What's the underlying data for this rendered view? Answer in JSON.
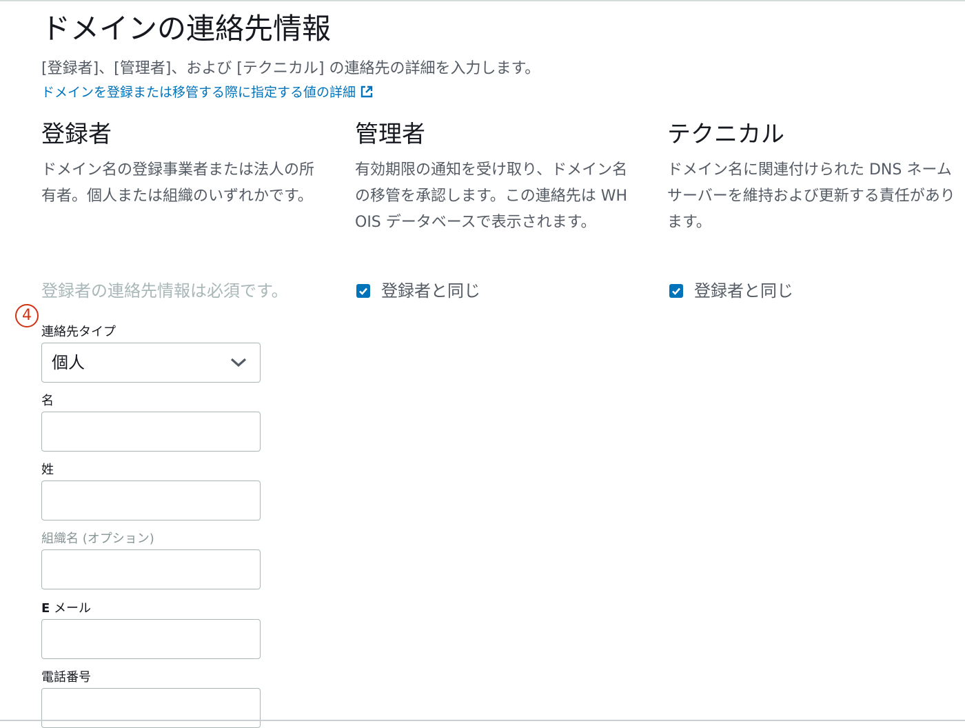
{
  "page": {
    "title": "ドメインの連絡先情報",
    "description": "[登録者]、[管理者]、および [テクニカル] の連絡先の詳細を入力します。",
    "learn_more_link": "ドメインを登録または移管する際に指定する値の詳細"
  },
  "columns": [
    {
      "heading": "登録者",
      "description": "ドメイン名の登録事業者または法人の所有者。個人または組織のいずれかです。"
    },
    {
      "heading": "管理者",
      "description": "有効期限の通知を受け取り、ドメイン名の移管を承認します。この連絡先は WHOIS データベースで表示されます。"
    },
    {
      "heading": "テクニカル",
      "description": "ドメイン名に関連付けられた DNS ネームサーバーを維持および更新する責任があります。"
    }
  ],
  "registrant": {
    "required_note": "登録者の連絡先情報は必須です。"
  },
  "admin": {
    "same_as_registrant_label": "登録者と同じ",
    "same_as_registrant_checked": true
  },
  "technical": {
    "same_as_registrant_label": "登録者と同じ",
    "same_as_registrant_checked": true
  },
  "step_marker": "4",
  "form": {
    "contact_type_label": "連絡先タイプ",
    "contact_type_value": "個人",
    "first_name_label": "名",
    "first_name_value": "",
    "last_name_label": "姓",
    "last_name_value": "",
    "organization_label": "組織名 (オプション)",
    "organization_value": "",
    "email_label_bold": "E",
    "email_label_rest": " メール",
    "email_value": "",
    "phone_label": "電話番号",
    "phone_value": ""
  },
  "colors": {
    "link": "#0073bb",
    "checkbox": "#0073bb",
    "step_marker": "#d13212",
    "muted_text": "#aab7b8"
  },
  "icons": {
    "external_link": "external-link-icon",
    "checkbox_check": "check-icon",
    "select_caret": "chevron-down-icon"
  }
}
